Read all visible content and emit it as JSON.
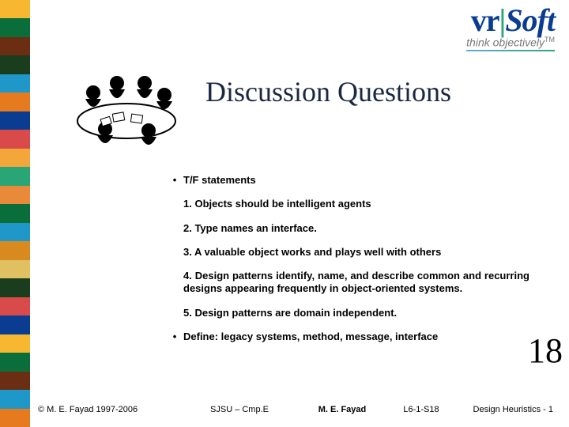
{
  "stripe_colors": [
    "#f7b731",
    "#0a6e3a",
    "#6b2e13",
    "#1a3e1d",
    "#1f97c9",
    "#e57b1e",
    "#0a3d91",
    "#d94a4a",
    "#f3a73a",
    "#2aa576",
    "#e88a3a",
    "#0a6e3a",
    "#1f97c9",
    "#d98a1e",
    "#e0c060",
    "#1a3e1d",
    "#d94a4a",
    "#0a3d91",
    "#f7b731",
    "#0a6e3a",
    "#6b2e13",
    "#1f97c9",
    "#e57b1e"
  ],
  "logo": {
    "part1": "vr",
    "bar": "|",
    "part2": "Soft",
    "tagline": "think objectively",
    "tm": "TM"
  },
  "title": "Discussion Questions",
  "bullets": {
    "b1_label": "T/F statements",
    "s1": "1. Objects should be intelligent agents",
    "s2": "2. Type names an interface.",
    "s3": "3. A valuable object works and plays well with others",
    "s4": "4. Design patterns identify, name, and describe common and recurring designs appearing frequently in object-oriented systems.",
    "s5": "5. Design patterns are domain independent.",
    "b2_label": "Define: legacy systems, method, message, interface"
  },
  "big_number": "18",
  "footer": {
    "copyright": "© M. E. Fayad 1997-2006",
    "center": "SJSU – Cmp.E",
    "author": "M. E. Fayad",
    "code": "L6-1-S18",
    "right": "Design Heuristics - 1"
  }
}
